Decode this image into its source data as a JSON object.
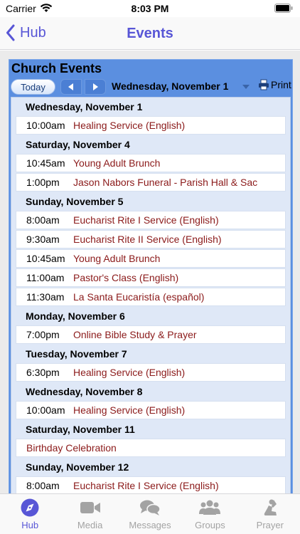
{
  "status_bar": {
    "carrier": "Carrier",
    "time": "8:03 PM"
  },
  "nav": {
    "back_label": "Hub",
    "title": "Events"
  },
  "calendar": {
    "title": "Church Events",
    "today_label": "Today",
    "current_date": "Wednesday, November 1",
    "print_label": "Print",
    "days": [
      {
        "date": "Wednesday, November 1",
        "events": [
          {
            "time": "10:00am",
            "title": "Healing Service (English)"
          }
        ]
      },
      {
        "date": "Saturday, November 4",
        "events": [
          {
            "time": "10:45am",
            "title": "Young Adult Brunch"
          },
          {
            "time": "1:00pm",
            "title": "Jason Nabors Funeral - Parish Hall & Sac"
          }
        ]
      },
      {
        "date": "Sunday, November 5",
        "events": [
          {
            "time": "8:00am",
            "title": "Eucharist Rite I Service (English)"
          },
          {
            "time": "9:30am",
            "title": "Eucharist Rite II Service (English)"
          },
          {
            "time": "10:45am",
            "title": "Young Adult Brunch"
          },
          {
            "time": "11:00am",
            "title": "Pastor's Class (English)"
          },
          {
            "time": "11:30am",
            "title": "La Santa Eucaristía (español)"
          }
        ]
      },
      {
        "date": "Monday, November 6",
        "events": [
          {
            "time": "7:00pm",
            "title": "Online Bible Study & Prayer"
          }
        ]
      },
      {
        "date": "Tuesday, November 7",
        "events": [
          {
            "time": "6:30pm",
            "title": "Healing Service (English)"
          }
        ]
      },
      {
        "date": "Wednesday, November 8",
        "events": [
          {
            "time": "10:00am",
            "title": "Healing Service (English)"
          }
        ]
      },
      {
        "date": "Saturday, November 11",
        "events": [
          {
            "time": "",
            "title": "Birthday Celebration"
          }
        ]
      },
      {
        "date": "Sunday, November 12",
        "events": [
          {
            "time": "8:00am",
            "title": "Eucharist Rite I Service (English)"
          }
        ]
      }
    ]
  },
  "tabs": [
    {
      "label": "Hub",
      "icon": "compass-icon",
      "active": true
    },
    {
      "label": "Media",
      "icon": "video-camera-icon",
      "active": false
    },
    {
      "label": "Messages",
      "icon": "chat-bubbles-icon",
      "active": false
    },
    {
      "label": "Groups",
      "icon": "people-icon",
      "active": false
    },
    {
      "label": "Prayer",
      "icon": "praying-person-icon",
      "active": false
    }
  ],
  "colors": {
    "accent": "#5856d6",
    "calendar_header": "#5b8fe0",
    "agenda_background": "#dfe8f7",
    "event_title": "#8b1a1a",
    "tab_inactive": "#a3a3a3"
  }
}
